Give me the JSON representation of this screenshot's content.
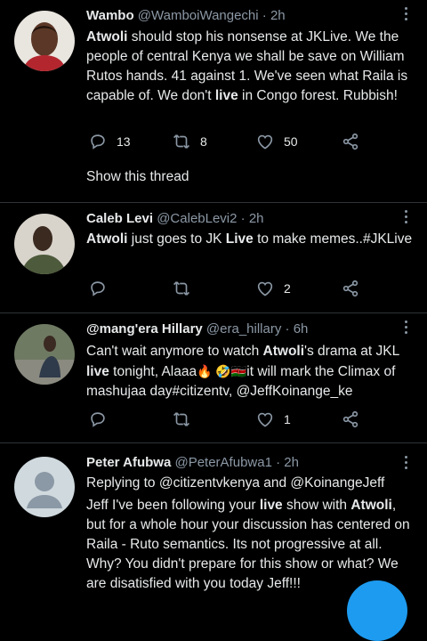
{
  "tweets": [
    {
      "name": "Wambo",
      "handle": "@WamboiWangechi",
      "time": "· 2h",
      "text": [
        "Atwoli",
        " should stop his nonsense at JKLive. We the people of central Kenya we shall be save on William Rutos hands. 41 against 1. We've seen what Raila is capable of. We don't ",
        "live",
        " in Congo forest. Rubbish!"
      ],
      "replies": "13",
      "retweets": "8",
      "likes": "50",
      "show_thread": "Show this thread"
    },
    {
      "name": "Caleb Levi",
      "handle": "@CalebLevi2",
      "time": "· 2h",
      "text": [
        "Atwoli",
        " just goes to JK ",
        "Live",
        " to make memes..#JKLive"
      ],
      "replies": "",
      "retweets": "",
      "likes": "2"
    },
    {
      "name": "@mang'era Hillary",
      "handle": "@era_hillary",
      "time": "· 6h",
      "text": [
        "Can't wait anymore to watch ",
        "Atwoli",
        "'s drama at JKL ",
        "live",
        " tonight, Alaaa",
        "🔥 🤣🇰🇪",
        "it will mark the Climax of mashujaa day#citizentv, @JeffKoinange_ke"
      ],
      "replies": "",
      "retweets": "",
      "likes": "1"
    },
    {
      "name": "Peter Afubwa",
      "handle": "@PeterAfubwa1",
      "time": "· 2h",
      "replying": "Replying to @citizentvkenya and @KoinangeJeff",
      "text": [
        "Jeff I've been following your ",
        "live",
        " show with ",
        "Atwoli",
        ", but for a whole hour your discussion has centered on Raila - Ruto semantics. Its not progressive at all. Why? You didn't prepare for this show or what? We are disatisfied with you today Jeff!!!"
      ]
    }
  ],
  "icons": [
    "reply-icon",
    "retweet-icon",
    "like-icon",
    "share-icon",
    "more-icon"
  ],
  "colors": {
    "background": "#000000",
    "text": "#e7e9ea",
    "muted": "#8b98a5",
    "accent": "#1d9bf0"
  }
}
